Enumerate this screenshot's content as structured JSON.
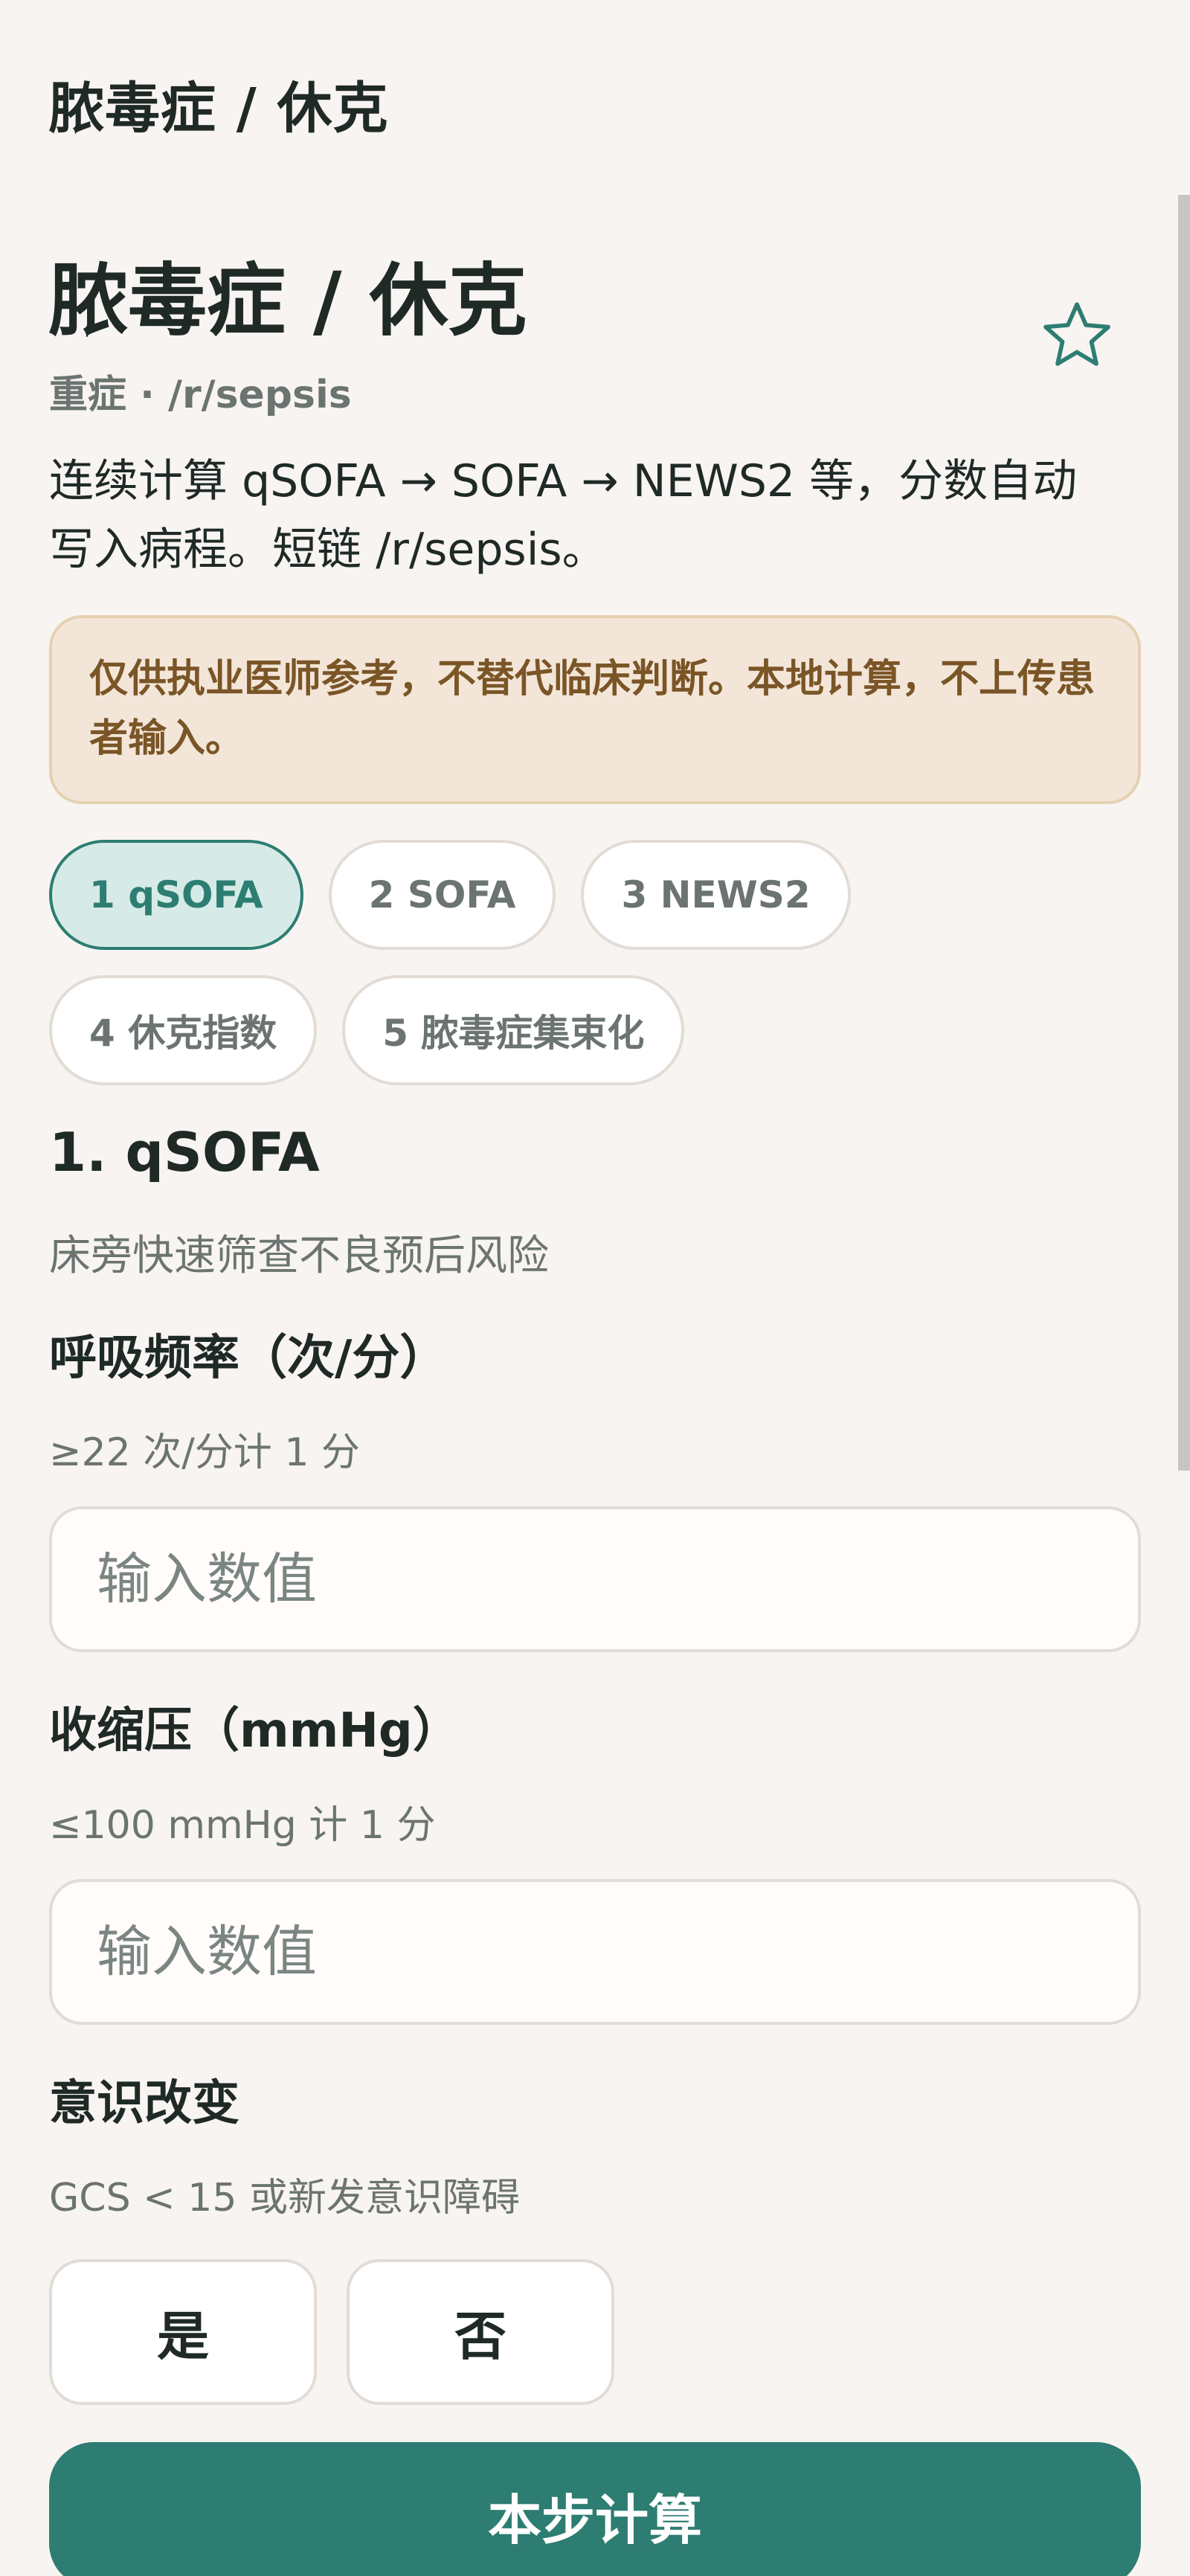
{
  "topbar": {
    "title": "脓毒症 / 休克"
  },
  "header": {
    "title": "脓毒症 / 休克",
    "subtitle": "重症 · /r/sepsis",
    "description": "连续计算 qSOFA → SOFA → NEWS2 等，分数自动写入病程。短链 /r/sepsis。",
    "favorite_icon": "star-outline-icon"
  },
  "notice": {
    "text": "仅供执业医师参考，不替代临床判断。本地计算，不上传患者输入。"
  },
  "steps": [
    {
      "label": "1 qSOFA",
      "active": true
    },
    {
      "label": "2 SOFA",
      "active": false
    },
    {
      "label": "3 NEWS2",
      "active": false
    },
    {
      "label": "4 休克指数",
      "active": false
    },
    {
      "label": "5 脓毒症集束化",
      "active": false
    }
  ],
  "section": {
    "title": "1. qSOFA",
    "subtitle": "床旁快速筛查不良预后风险"
  },
  "fields": [
    {
      "label": "呼吸频率（次/分）",
      "hint": "≥22 次/分计 1 分",
      "value": "",
      "placeholder": "输入数值"
    },
    {
      "label": "收缩压（mmHg）",
      "hint": "≤100 mmHg 计 1 分",
      "value": "",
      "placeholder": "输入数值"
    }
  ],
  "consciousness": {
    "label": "意识改变",
    "hint": "GCS < 15 或新发意识障碍",
    "options": [
      "是",
      "否"
    ]
  },
  "actions": {
    "compute_label": "本步计算"
  },
  "colors": {
    "accent": "#2d7d72",
    "background": "#f8f4f1",
    "notice_bg": "#f3e6d8",
    "notice_text": "#7a5526"
  }
}
